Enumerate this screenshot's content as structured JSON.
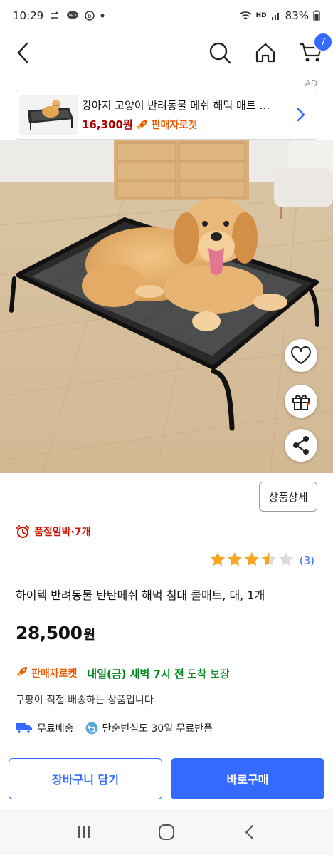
{
  "status_bar": {
    "time": "10:29",
    "battery": "83%",
    "network_badge": "HD"
  },
  "nav": {
    "cart_count": "7",
    "icons": [
      "back-arrow-icon",
      "search-icon",
      "home-icon",
      "cart-icon"
    ]
  },
  "ad": {
    "label": "AD",
    "title": "강아지 고양이 반려동물 메쉬 해먹 매트 …",
    "price": "16,300원",
    "rocket_label": "판매자로켓"
  },
  "floating_actions": [
    "heart-icon",
    "gift-icon",
    "share-icon"
  ],
  "detail_button": "상품상세",
  "stock": {
    "text": "품절임박·7개"
  },
  "rating": {
    "stars": 3.5,
    "max": 5,
    "count": "(3)"
  },
  "product": {
    "name": "하이텍 반려동물 탄탄메쉬 해먹 침대 쿨매트, 대, 1개",
    "price": "28,500",
    "price_unit": "원"
  },
  "delivery": {
    "rocket_label": "판매자로켓",
    "date": "내일(금) 새벽 7시 전",
    "suffix": "도착 보장"
  },
  "direct_ship": "쿠팡이 직접 배송하는 상품입니다",
  "benefits": [
    {
      "icon": "truck-icon",
      "label": "무료배송"
    },
    {
      "icon": "return-icon",
      "label": "단순변심도 30일 무료반품"
    }
  ],
  "cta": {
    "cart": "장바구니 담기",
    "buy": "바로구매"
  },
  "colors": {
    "accent": "#346aff",
    "price_red": "#ae0000",
    "rocket_orange": "#e75b00",
    "delivery_green": "#00891a",
    "stock_red": "#cb1400",
    "star": "#f5a623"
  }
}
